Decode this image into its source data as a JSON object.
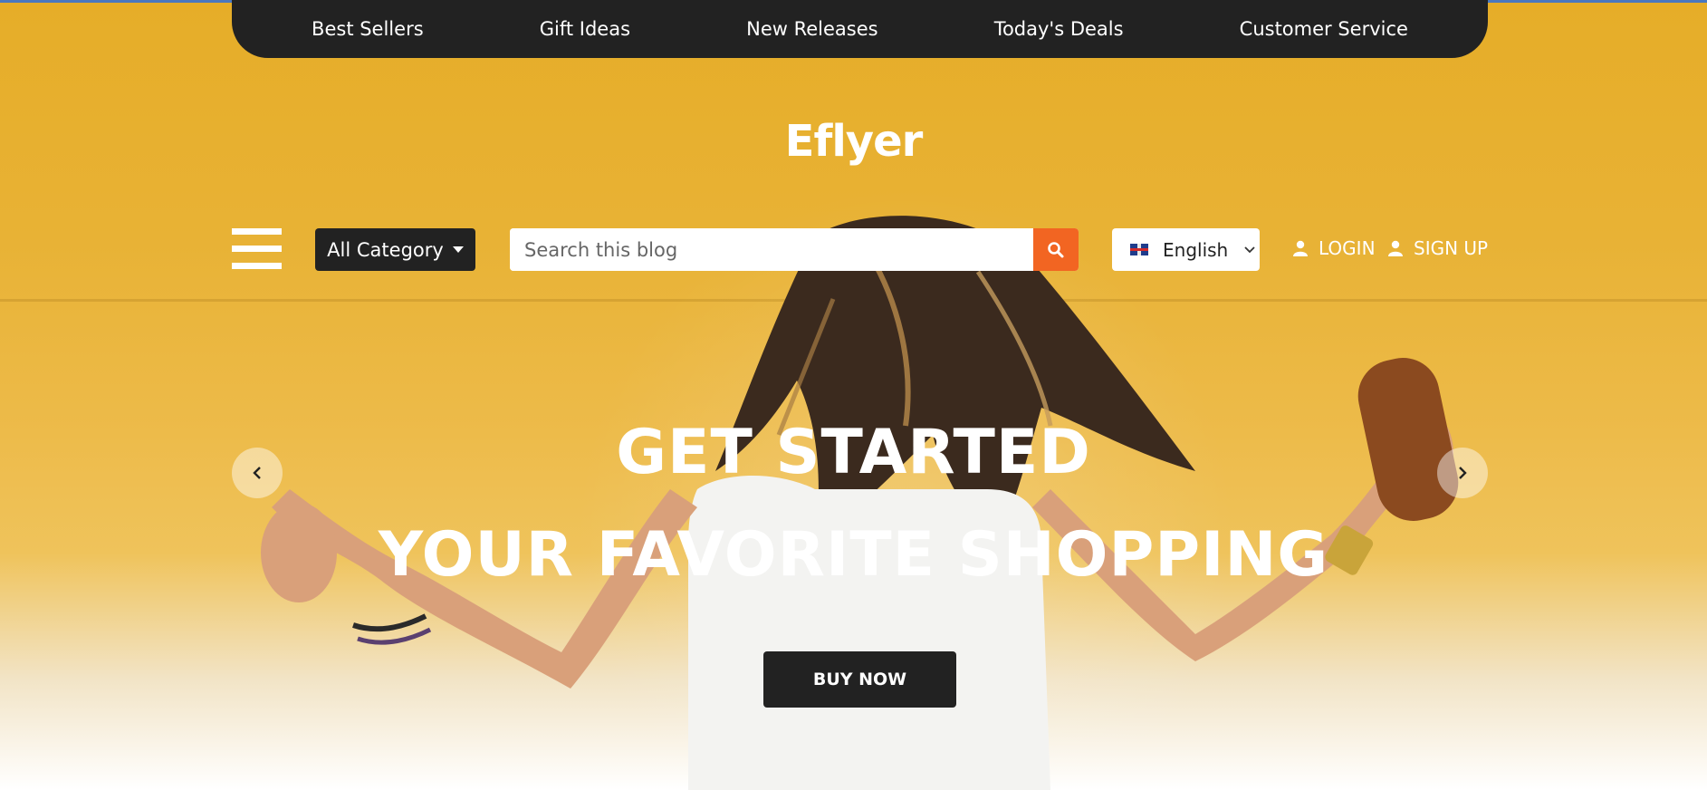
{
  "nav": {
    "items": [
      "Best Sellers",
      "Gift Ideas",
      "New Releases",
      "Today's Deals",
      "Customer Service"
    ]
  },
  "brand": {
    "logo": "Eflyer"
  },
  "toolbar": {
    "category_label": "All Category",
    "search_placeholder": "Search this blog",
    "language": "English",
    "login_label": "LOGIN",
    "signup_label": "SIGN UP"
  },
  "hero": {
    "line1": "GET STARTED",
    "line2": "YOUR FAVORITE SHOPPING",
    "cta": "BUY NOW"
  },
  "colors": {
    "accent": "#f26522",
    "dark": "#222222",
    "hero_bg": "#e6ad28"
  },
  "icons": {
    "menu": "hamburger-icon",
    "search": "search-icon",
    "flag": "uk-flag-icon",
    "user": "user-icon",
    "prev": "chevron-left-icon",
    "next": "chevron-right-icon"
  }
}
